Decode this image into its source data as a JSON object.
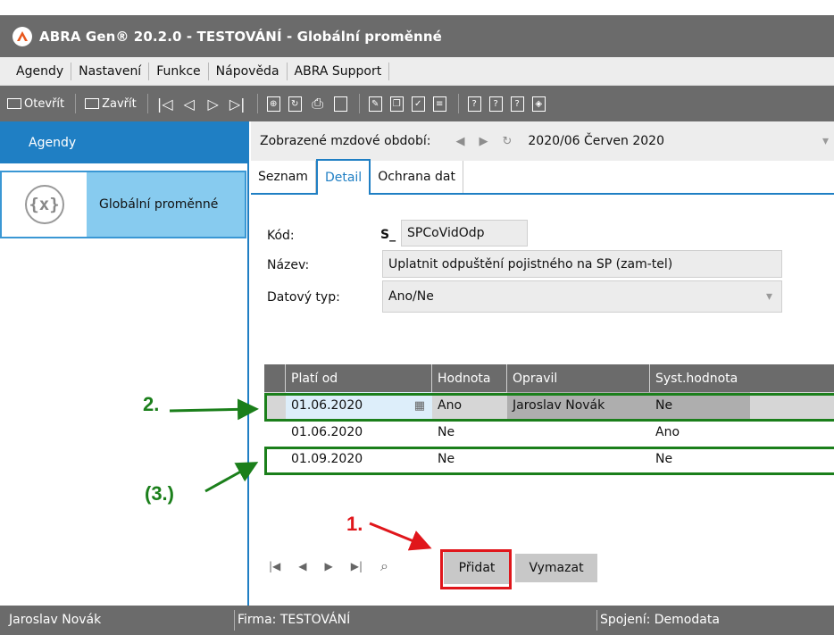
{
  "window": {
    "title": "ABRA Gen® 20.2.0 - TESTOVÁNÍ - Globální proměnné"
  },
  "menu": [
    "Agendy",
    "Nastavení",
    "Funkce",
    "Nápověda",
    "ABRA Support"
  ],
  "toolbar": {
    "open_label": "Otevřít",
    "close_label": "Zavřít"
  },
  "sidebar": {
    "header": "Agendy",
    "item_label": "Globální proměnné",
    "item_icon_text": "{x}"
  },
  "period": {
    "label": "Zobrazené mzdové období:",
    "value": "2020/06 Červen 2020"
  },
  "tabs": [
    "Seznam",
    "Detail",
    "Ochrana dat"
  ],
  "form": {
    "kod_label": "Kód:",
    "kod_prefix": "S_",
    "kod_value": "SPCoVidOdp",
    "nazev_label": "Název:",
    "nazev_value": "Uplatnit odpuštění pojistného na SP (zam-tel)",
    "typ_label": "Datový typ:",
    "typ_value": "Ano/Ne"
  },
  "grid": {
    "headers": [
      "Platí od",
      "Hodnota",
      "Opravil",
      "Syst.hodnota"
    ],
    "rows": [
      {
        "plati_od": "01.06.2020",
        "hodnota": "Ano",
        "opravil": "Jaroslav Novák",
        "syst": "Ne"
      },
      {
        "plati_od": "01.06.2020",
        "hodnota": "Ne",
        "opravil": "",
        "syst": "Ano"
      },
      {
        "plati_od": "01.09.2020",
        "hodnota": "Ne",
        "opravil": "",
        "syst": "Ne"
      }
    ]
  },
  "buttons": {
    "add": "Přidat",
    "delete": "Vymazat"
  },
  "annotations": {
    "one": "1.",
    "two": "2.",
    "three": "(3.)"
  },
  "status": {
    "user": "Jaroslav Novák",
    "firm": "Firma: TESTOVÁNÍ",
    "connection": "Spojení: Demodata"
  },
  "colors": {
    "accent": "#1f7fc4",
    "annotation_green": "#1b7f1b",
    "annotation_red": "#e0161b"
  }
}
